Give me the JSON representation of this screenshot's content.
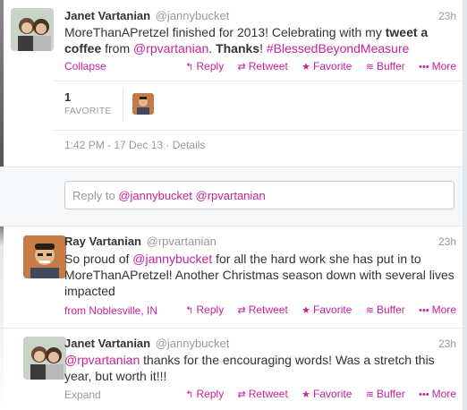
{
  "colors": {
    "accent": "#c6219b",
    "muted": "#999999",
    "text": "#333333"
  },
  "tweet1": {
    "name": "Janet Vartanian",
    "handle": "@jannybucket",
    "time": "23h",
    "text_a": "MoreThanAPretzel finished for 2013!  Celebrating with my ",
    "text_bold1": "tweet a coffee",
    "text_b": " from ",
    "text_mention": "@rpvartanian",
    "text_c": ". ",
    "text_bold2": "Thanks",
    "text_d": "! ",
    "text_hashtag": "#BlessedBeyondMeasure",
    "collapse": "Collapse",
    "favorites_count": "1",
    "favorites_label": "FAVORITE",
    "timestamp": "1:42 PM - 17 Dec 13",
    "details": "Details"
  },
  "actions": {
    "reply": "Reply",
    "retweet": "Retweet",
    "favorite": "Favorite",
    "buffer": "Buffer",
    "more": "More"
  },
  "icons": {
    "reply": "reply-arrow-icon",
    "retweet": "retweet-icon",
    "favorite": "star-icon",
    "buffer": "buffer-layers-icon",
    "more": "more-dots-icon"
  },
  "reply_box": {
    "prefix": "Reply to ",
    "mention1": "@jannybucket",
    "mention2": "@rpvartanian"
  },
  "tweet2": {
    "name": "Ray Vartanian",
    "handle": "@rpvartanian",
    "time": "23h",
    "text_a": "So proud of ",
    "text_mention": "@jannybucket",
    "text_b": " for all the hard work she has put in to MoreThanAPretzel! Another Christmas season down with several lives impacted",
    "location": "from Noblesville, IN"
  },
  "tweet3": {
    "name": "Janet Vartanian",
    "handle": "@jannybucket",
    "time": "23h",
    "text_mention": "@rpvartanian",
    "text_a": " thanks for the encouraging  words!  Was a stretch this year, but worth it!!!",
    "expand": "Expand"
  }
}
